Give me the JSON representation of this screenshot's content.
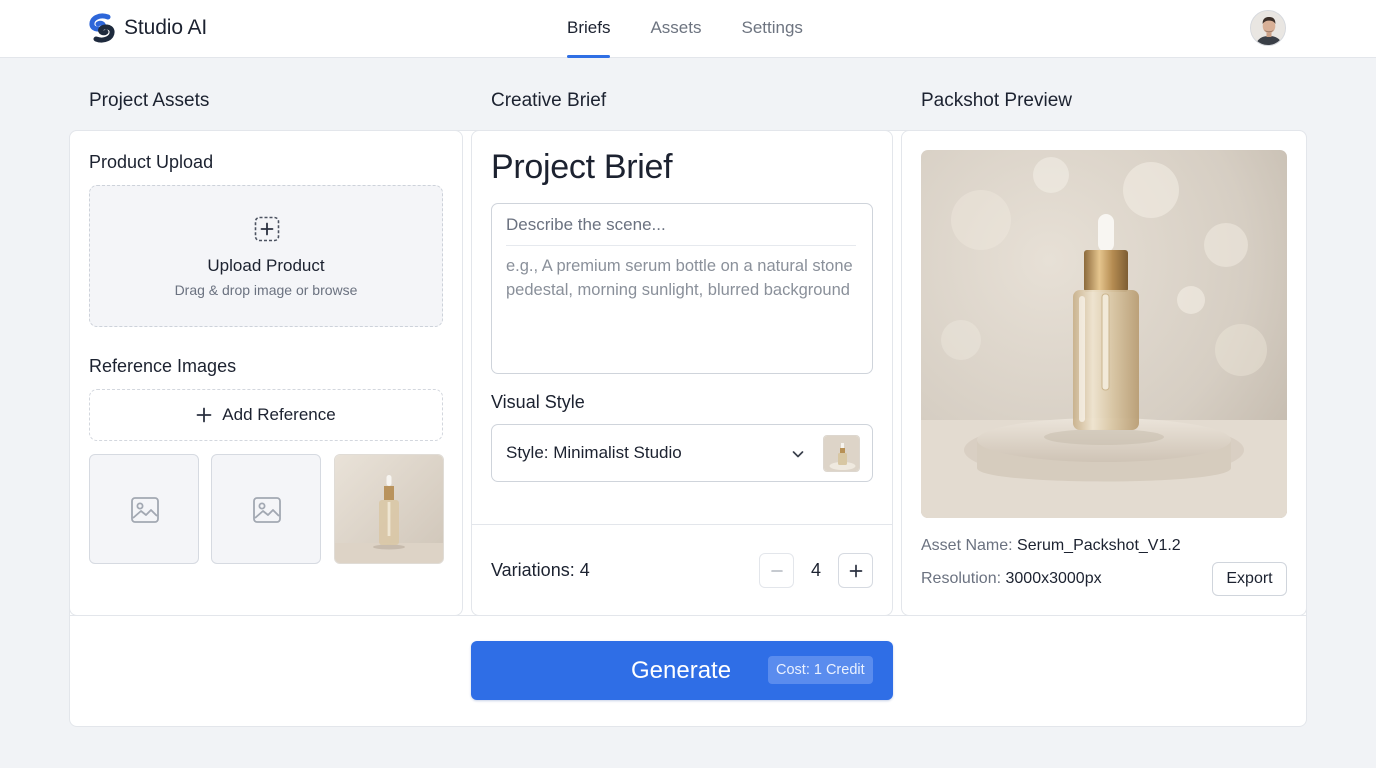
{
  "app": {
    "name": "Studio AI"
  },
  "nav": {
    "tabs": [
      {
        "label": "Briefs",
        "active": true
      },
      {
        "label": "Assets",
        "active": false
      },
      {
        "label": "Settings",
        "active": false
      }
    ]
  },
  "user": {
    "avatar_icon": "user-avatar"
  },
  "columns": {
    "left": {
      "heading": "Project Assets"
    },
    "middle": {
      "heading": "Creative Brief"
    },
    "right": {
      "heading": "Packshot Preview"
    }
  },
  "assets": {
    "product_upload": {
      "heading": "Product Upload",
      "title": "Upload Product",
      "subtitle": "Drag & drop image or browse"
    },
    "references": {
      "heading": "Reference Images",
      "add_label": "Add Reference",
      "thumbnails": [
        {
          "kind": "placeholder",
          "icon": "image-placeholder-icon"
        },
        {
          "kind": "placeholder",
          "icon": "image-placeholder-icon"
        },
        {
          "kind": "photo"
        }
      ]
    }
  },
  "brief": {
    "title": "Project Brief",
    "scene_placeholder": "Describe the scene...",
    "description_placeholder": "e.g., A premium serum bottle on a natural stone pedestal, morning sunlight, blurred background",
    "visual_style": {
      "heading": "Visual Style",
      "selected": "Style: Minimalist Studio"
    },
    "variations": {
      "label": "Variations: 4",
      "value": "4"
    }
  },
  "preview": {
    "asset_name_label": "Asset Name:",
    "asset_name": "Serum_Packshot_V1.2",
    "resolution_label": "Resolution:",
    "resolution": "3000x3000px",
    "export_label": "Export"
  },
  "generate": {
    "label": "Generate",
    "cost": "Cost: 1 Credit"
  },
  "colors": {
    "accent": "#2f6ee6",
    "background": "#f1f3f6",
    "panel": "#ffffff"
  }
}
